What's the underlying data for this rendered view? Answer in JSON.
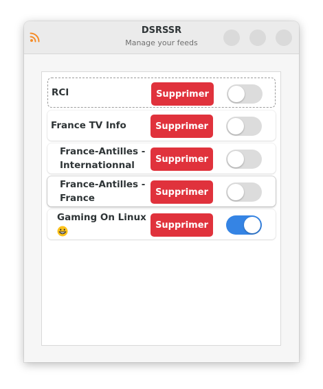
{
  "window": {
    "title": "DSRSSR",
    "subtitle": "Manage your feeds"
  },
  "colors": {
    "delete_button": "#e0323c",
    "switch_on": "#3584e4",
    "switch_off": "#dcdcdc",
    "rss_icon": "#f58c28"
  },
  "feeds": [
    {
      "name": "RCI",
      "delete_label": "Supprimer",
      "enabled": false
    },
    {
      "name": "France TV Info",
      "delete_label": "Supprimer",
      "enabled": false
    },
    {
      "name": "France-Antilles - Internationnal",
      "delete_label": "Supprimer",
      "enabled": false
    },
    {
      "name": "France-Antilles - France",
      "delete_label": "Supprimer",
      "enabled": false
    },
    {
      "name": "Gaming On Linux",
      "delete_label": "Supprimer",
      "enabled": true,
      "emoji": "grinning-face-icon"
    }
  ]
}
